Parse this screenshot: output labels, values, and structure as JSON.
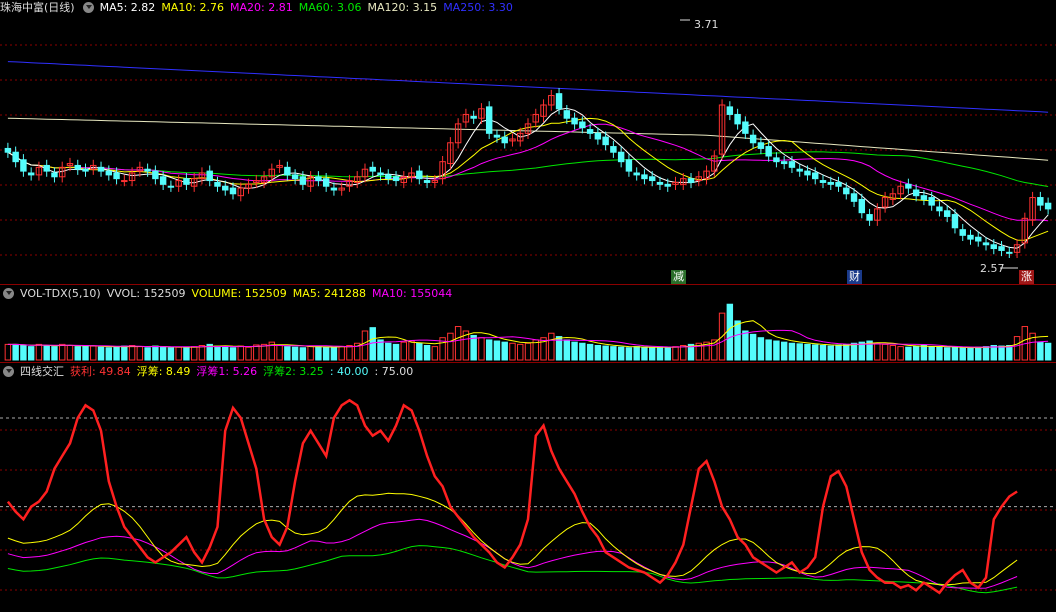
{
  "header": {
    "title": "珠海中富(日线)",
    "ma5": "MA5: 2.82",
    "ma10": "MA10: 2.76",
    "ma20": "MA20: 2.81",
    "ma60": "MA60: 3.06",
    "ma120": "MA120: 3.15",
    "ma250": "MA250: 3.30"
  },
  "price_chart": {
    "high_label": "3.71",
    "low_label": "2.57",
    "markers": [
      "减",
      "财",
      "涨"
    ]
  },
  "volume_header": {
    "name": "VOL-TDX(5,10)",
    "vvol": "VVOL: 152509",
    "volume": "VOLUME: 152509",
    "ma5": "MA5: 241288",
    "ma10": "MA10: 155044"
  },
  "indicator_header": {
    "name": "四线交汇",
    "profit": "获利: 49.84",
    "float1": "浮筹: 8.49",
    "float2": "浮筹1: 5.26",
    "float3": "浮筹2: 3.25",
    "level40": ": 40.00",
    "level75": ": 75.00"
  },
  "colors": {
    "up": "#ff3232",
    "down": "#54fcfc",
    "ma5": "#ffffff",
    "ma10": "#ffff00",
    "ma20": "#ff00ff",
    "ma60": "#00e600",
    "ma120": "#e8e8c0",
    "ma250": "#3030ff",
    "grid": "#8b0000"
  },
  "chart_data": {
    "type": "candlestick",
    "price_range": [
      2.57,
      3.71
    ],
    "close": [
      3.1,
      3.05,
      3.0,
      2.98,
      3.02,
      3.0,
      2.97,
      3.02,
      3.04,
      3.01,
      3.0,
      3.03,
      3.0,
      2.98,
      2.96,
      2.95,
      2.99,
      3.02,
      3.0,
      2.96,
      2.93,
      2.92,
      2.95,
      2.93,
      2.96,
      2.99,
      2.95,
      2.92,
      2.9,
      2.88,
      2.91,
      2.93,
      2.95,
      2.97,
      3.01,
      3.03,
      2.98,
      2.96,
      2.93,
      2.97,
      2.95,
      2.92,
      2.9,
      2.91,
      2.95,
      2.97,
      3.01,
      3.0,
      2.98,
      2.96,
      2.95,
      2.97,
      2.99,
      2.96,
      2.94,
      2.95,
      3.05,
      3.15,
      3.25,
      3.3,
      3.28,
      3.33,
      3.2,
      3.18,
      3.15,
      3.17,
      3.2,
      3.25,
      3.3,
      3.35,
      3.4,
      3.33,
      3.28,
      3.25,
      3.23,
      3.2,
      3.17,
      3.14,
      3.1,
      3.05,
      3.0,
      2.98,
      2.96,
      2.95,
      2.93,
      2.92,
      2.94,
      2.96,
      2.94,
      2.97,
      3.0,
      3.08,
      3.35,
      3.3,
      3.25,
      3.2,
      3.15,
      3.12,
      3.08,
      3.05,
      3.04,
      3.02,
      3.0,
      2.98,
      2.96,
      2.94,
      2.93,
      2.92,
      2.88,
      2.84,
      2.78,
      2.74,
      2.8,
      2.86,
      2.88,
      2.92,
      2.91,
      2.87,
      2.85,
      2.82,
      2.79,
      2.76,
      2.7,
      2.66,
      2.64,
      2.63,
      2.61,
      2.59,
      2.58,
      2.57,
      2.61,
      2.75,
      2.86,
      2.82,
      2.8
    ],
    "volume": [
      140,
      140,
      130,
      120,
      140,
      130,
      120,
      140,
      130,
      120,
      130,
      125,
      115,
      110,
      120,
      125,
      130,
      120,
      110,
      125,
      120,
      110,
      115,
      110,
      120,
      130,
      140,
      125,
      120,
      110,
      125,
      115,
      135,
      140,
      160,
      130,
      120,
      115,
      110,
      125,
      120,
      115,
      110,
      120,
      130,
      150,
      260,
      290,
      180,
      150,
      140,
      160,
      170,
      150,
      130,
      120,
      200,
      240,
      300,
      260,
      220,
      200,
      180,
      170,
      160,
      150,
      140,
      150,
      180,
      200,
      240,
      210,
      180,
      160,
      150,
      140,
      130,
      125,
      120,
      115,
      110,
      120,
      115,
      110,
      118,
      112,
      120,
      130,
      140,
      150,
      160,
      180,
      420,
      500,
      350,
      260,
      230,
      200,
      180,
      170,
      160,
      150,
      145,
      140,
      135,
      130,
      125,
      135,
      140,
      150,
      160,
      170,
      150,
      140,
      130,
      120,
      115,
      125,
      130,
      120,
      115,
      110,
      112,
      108,
      110,
      115,
      120,
      130,
      125,
      130,
      210,
      300,
      240,
      160,
      150
    ],
    "profit": [
      62,
      58,
      55,
      60,
      62,
      66,
      75,
      80,
      85,
      95,
      100,
      98,
      90,
      70,
      60,
      52,
      48,
      44,
      40,
      38,
      40,
      42,
      45,
      48,
      42,
      38,
      44,
      52,
      90,
      99,
      95,
      85,
      75,
      55,
      48,
      45,
      52,
      70,
      85,
      90,
      85,
      80,
      95,
      100,
      102,
      100,
      92,
      88,
      90,
      86,
      92,
      100,
      98,
      90,
      80,
      72,
      68,
      60,
      56,
      52,
      48,
      45,
      42,
      38,
      36,
      40,
      45,
      55,
      88,
      92,
      82,
      75,
      70,
      65,
      58,
      52,
      48,
      42,
      40,
      38,
      36,
      35,
      34,
      32,
      30,
      33,
      38,
      45,
      60,
      75,
      78,
      70,
      60,
      55,
      48,
      45,
      40,
      38,
      36,
      34,
      36,
      38,
      34,
      36,
      40,
      60,
      72,
      74,
      68,
      55,
      42,
      35,
      32,
      30,
      30,
      28,
      29,
      27,
      30,
      28,
      26,
      30,
      33,
      35,
      30,
      28,
      32,
      55,
      60,
      64,
      66
    ],
    "levels": [
      40,
      75
    ]
  }
}
